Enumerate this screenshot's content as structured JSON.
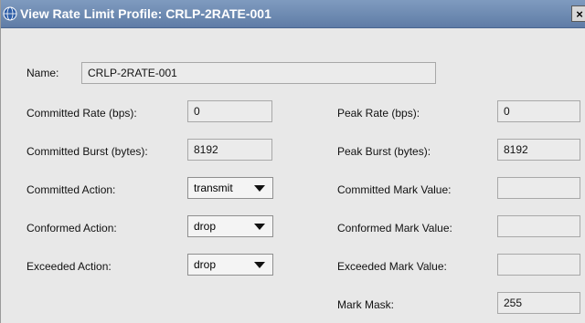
{
  "window": {
    "title": "View Rate Limit Profile: CRLP-2RATE-001",
    "close_glyph": "×"
  },
  "form": {
    "name_label": "Name:",
    "name_value": "CRLP-2RATE-001",
    "committed_rate_label": "Committed Rate (bps):",
    "committed_rate_value": "0",
    "committed_burst_label": "Committed Burst (bytes):",
    "committed_burst_value": "8192",
    "committed_action_label": "Committed Action:",
    "committed_action_value": "transmit",
    "conformed_action_label": "Conformed Action:",
    "conformed_action_value": "drop",
    "exceeded_action_label": "Exceeded Action:",
    "exceeded_action_value": "drop",
    "peak_rate_label": "Peak Rate (bps):",
    "peak_rate_value": "0",
    "peak_burst_label": "Peak Burst (bytes):",
    "peak_burst_value": "8192",
    "committed_mark_label": "Committed Mark Value:",
    "committed_mark_value": "",
    "conformed_mark_label": "Conformed Mark Value:",
    "conformed_mark_value": "",
    "exceeded_mark_label": "Exceeded Mark Value:",
    "exceeded_mark_value": "",
    "mark_mask_label": "Mark Mask:",
    "mark_mask_value": "255"
  },
  "colors": {
    "titlebar": "#6b88b2",
    "window_bg": "#e8e8e8",
    "field_bg": "#ebebeb"
  },
  "icons": {
    "title_icon": "app-globe-icon",
    "close_icon": "close-icon",
    "dropdown_icon": "chevron-down-icon"
  }
}
